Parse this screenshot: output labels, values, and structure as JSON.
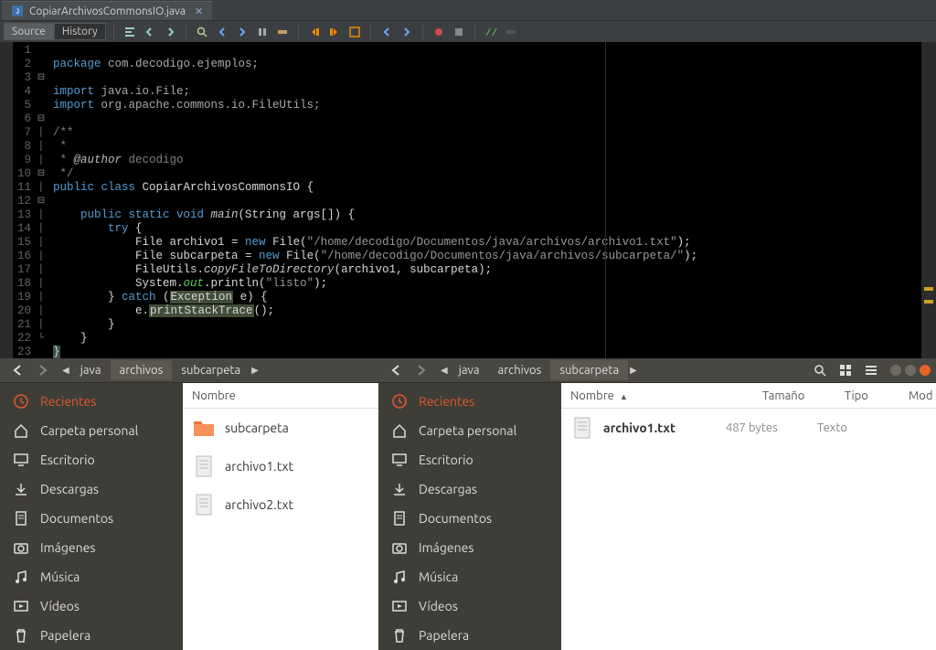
{
  "ide": {
    "tab_title": "CopiarArchivosCommonsIO.java",
    "toolbar": {
      "source_label": "Source",
      "history_label": "History"
    },
    "lines": [
      "1",
      "2",
      "3",
      "4",
      "5",
      "6",
      "7",
      "8",
      "9",
      "10",
      "11",
      "12",
      "13",
      "14",
      "15",
      "16",
      "17",
      "18",
      "19",
      "20",
      "21",
      "22",
      "23"
    ],
    "code": {
      "l1_kw": "package",
      "l1_rest": " com.decodigo.ejemplos;",
      "l3_kw": "import",
      "l3_rest": " java.io.File;",
      "l4_kw": "import",
      "l4_rest": " org.apache.commons.io.FileUtils;",
      "l6": "/**",
      "l7": " *",
      "l8a": " * ",
      "l8b": "@author",
      "l8c": " decodigo",
      "l9": " */",
      "l10a": "public class ",
      "l10b": "CopiarArchivosCommonsIO",
      "l10c": " {",
      "l12a": "    public static void ",
      "l12b": "main",
      "l12c": "(String args[]) {",
      "l13a": "        try",
      "l13b": " {",
      "l14a": "            File archivo1 = ",
      "l14b": "new",
      "l14c": " File(",
      "l14d": "\"/home/decodigo/Documentos/java/archivos/archivo1.txt\"",
      "l14e": ");",
      "l15a": "            File subcarpeta = ",
      "l15b": "new",
      "l15c": " File(",
      "l15d": "\"/home/decodigo/Documentos/java/archivos/subcarpeta/\"",
      "l15e": ");",
      "l16a": "            FileUtils.",
      "l16b": "copyFileToDirectory",
      "l16c": "(archivo1, subcarpeta);",
      "l17a": "            System.",
      "l17b": "out",
      "l17c": ".println(",
      "l17d": "\"listo\"",
      "l17e": ");",
      "l18a": "        } ",
      "l18b": "catch",
      "l18c": " (",
      "l18d": "Exception",
      "l18e": " e) {",
      "l19a": "            e.",
      "l19b": "printStackTrace",
      "l19c": "();",
      "l20": "        }",
      "l21": "    }",
      "l22": "}"
    }
  },
  "fm_left": {
    "path": [
      "java",
      "archivos",
      "subcarpeta"
    ],
    "active_path_index": 1,
    "columns": {
      "name": "Nombre"
    },
    "files": [
      {
        "name": "subcarpeta",
        "type": "folder"
      },
      {
        "name": "archivo1.txt",
        "type": "text"
      },
      {
        "name": "archivo2.txt",
        "type": "text"
      }
    ]
  },
  "fm_right": {
    "path": [
      "java",
      "archivos",
      "subcarpeta"
    ],
    "active_path_index": 2,
    "columns": {
      "name": "Nombre",
      "size": "Tamaño",
      "type": "Tipo",
      "mod": "Mod"
    },
    "files": [
      {
        "name": "archivo1.txt",
        "size": "487 bytes",
        "type": "Texto"
      }
    ]
  },
  "sidebar": {
    "items": [
      {
        "label": "Recientes",
        "icon": "clock"
      },
      {
        "label": "Carpeta personal",
        "icon": "home"
      },
      {
        "label": "Escritorio",
        "icon": "desktop"
      },
      {
        "label": "Descargas",
        "icon": "download"
      },
      {
        "label": "Documentos",
        "icon": "document"
      },
      {
        "label": "Imágenes",
        "icon": "camera"
      },
      {
        "label": "Música",
        "icon": "music"
      },
      {
        "label": "Vídeos",
        "icon": "video"
      },
      {
        "label": "Papelera",
        "icon": "trash"
      }
    ],
    "active_index": 0
  }
}
